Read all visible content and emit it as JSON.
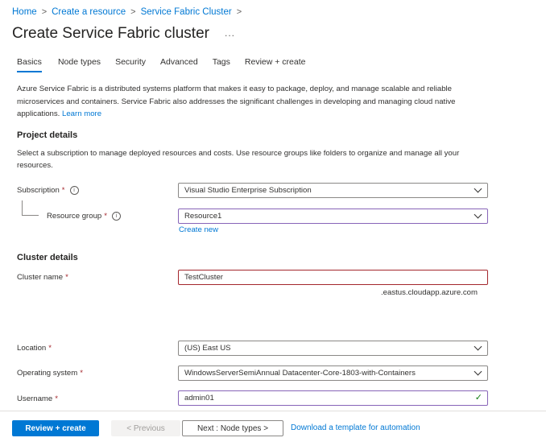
{
  "breadcrumb": {
    "items": [
      "Home",
      "Create a resource",
      "Service Fabric Cluster"
    ],
    "separator": ">"
  },
  "page": {
    "title": "Create Service Fabric cluster",
    "more": "..."
  },
  "tabs": [
    {
      "label": "Basics",
      "active": true
    },
    {
      "label": "Node types"
    },
    {
      "label": "Security"
    },
    {
      "label": "Advanced"
    },
    {
      "label": "Tags"
    },
    {
      "label": "Review + create"
    }
  ],
  "intro": {
    "text": "Azure Service Fabric is a distributed systems platform that makes it easy to package, deploy, and manage scalable and reliable microservices and containers. Service Fabric also addresses the significant challenges in developing and managing cloud native applications.",
    "link": "Learn more"
  },
  "project": {
    "heading": "Project details",
    "description": "Select a subscription to manage deployed resources and costs. Use resource groups like folders to organize and manage all your resources.",
    "subscription_label": "Subscription",
    "subscription_value": "Visual Studio Enterprise Subscription",
    "resource_group_label": "Resource group",
    "resource_group_value": "Resource1",
    "create_new": "Create new"
  },
  "cluster": {
    "heading": "Cluster details",
    "name_label": "Cluster name",
    "name_value": "TestCluster",
    "name_suffix": ".eastus.cloudapp.azure.com",
    "location_label": "Location",
    "location_value": "(US) East US",
    "os_label": "Operating system",
    "os_value": "WindowsServerSemiAnnual Datacenter-Core-1803-with-Containers",
    "username_label": "Username",
    "username_value": "admin01"
  },
  "footer": {
    "review_create": "Review + create",
    "previous": "< Previous",
    "next": "Next : Node types >",
    "download": "Download a template for automation"
  },
  "colors": {
    "accent": "#0078d4",
    "required": "#a4262c",
    "valid": "#107c10"
  }
}
